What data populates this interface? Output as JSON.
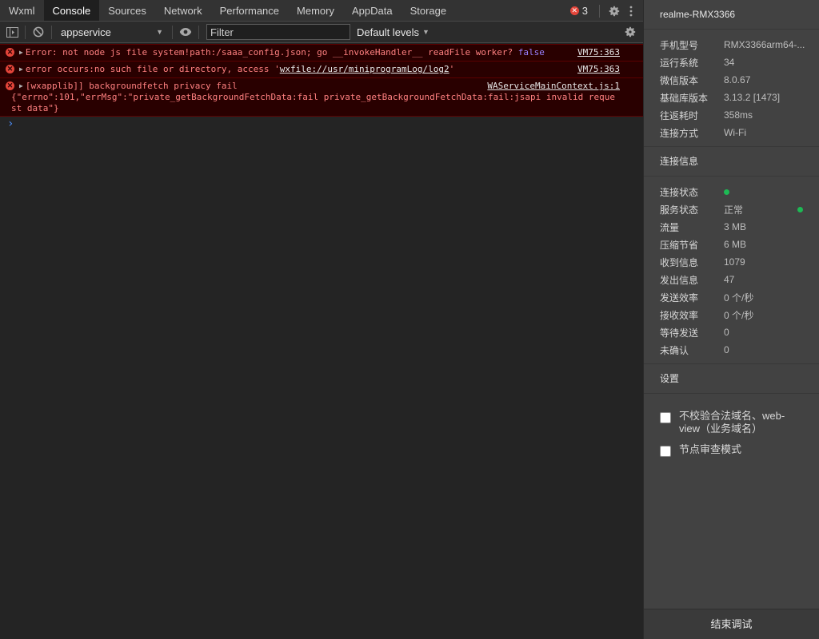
{
  "tabs": [
    {
      "label": "Wxml",
      "active": false
    },
    {
      "label": "Console",
      "active": true
    },
    {
      "label": "Sources",
      "active": false
    },
    {
      "label": "Network",
      "active": false
    },
    {
      "label": "Performance",
      "active": false
    },
    {
      "label": "Memory",
      "active": false
    },
    {
      "label": "AppData",
      "active": false
    },
    {
      "label": "Storage",
      "active": false
    }
  ],
  "error_count": "3",
  "toolbar": {
    "context": "appservice",
    "filter_placeholder": "Filter",
    "levels": "Default levels",
    "icons": [
      "sidebar-toggle-icon",
      "clear-console-icon",
      "eye-icon",
      "settings-gear-icon"
    ]
  },
  "console": {
    "messages": [
      {
        "text": "Error: not node js file system!path:/saaa_config.json; go __invokeHandler__ readFile worker? ",
        "keyword": "false",
        "source": "VM75:363"
      },
      {
        "text_before": "error occurs:no such file or directory, access '",
        "link": "wxfile://usr/miniprogramLog/log2",
        "text_after": "'",
        "source": "VM75:363"
      },
      {
        "text": "[wxapplib]] backgroundfetch privacy fail",
        "detail": "{\"errno\":101,\"errMsg\":\"private_getBackgroundFetchData:fail private_getBackgroundFetchData:fail:jsapi invalid request data\"}",
        "source": "WAServiceMainContext.js:1"
      }
    ],
    "prompt": "›"
  },
  "panel": {
    "device_title": "realme-RMX3366",
    "device_info": [
      {
        "key": "手机型号",
        "value": "RMX3366arm64-..."
      },
      {
        "key": "运行系统",
        "value": "34"
      },
      {
        "key": "微信版本",
        "value": "8.0.67"
      },
      {
        "key": "基础库版本",
        "value": "3.13.2 [1473]"
      },
      {
        "key": "往返耗时",
        "value": "358ms"
      },
      {
        "key": "连接方式",
        "value": "Wi-Fi"
      }
    ],
    "connection_head": "连接信息",
    "connection_info": [
      {
        "key": "连接状态",
        "value": ""
      },
      {
        "key": "服务状态",
        "value": "正常"
      },
      {
        "key": "流量",
        "value": "3 MB"
      },
      {
        "key": "压缩节省",
        "value": "6 MB"
      },
      {
        "key": "收到信息",
        "value": "1079"
      },
      {
        "key": "发出信息",
        "value": "47"
      },
      {
        "key": "发送效率",
        "value": "0 个/秒"
      },
      {
        "key": "接收效率",
        "value": "0 个/秒"
      },
      {
        "key": "等待发送",
        "value": "0"
      },
      {
        "key": "未确认",
        "value": "0"
      }
    ],
    "status_color": "#1db954",
    "settings_head": "设置",
    "checkboxes": [
      {
        "label": "不校验合法域名、web-view（业务域名）",
        "checked": false
      },
      {
        "label": "节点审查模式",
        "checked": false
      }
    ],
    "end_button": "结束调试"
  },
  "colors": {
    "error_bg": "#290000",
    "error_text": "#ff8080",
    "keyword": "#9980ff",
    "accent_blue": "#4b8bf5"
  }
}
